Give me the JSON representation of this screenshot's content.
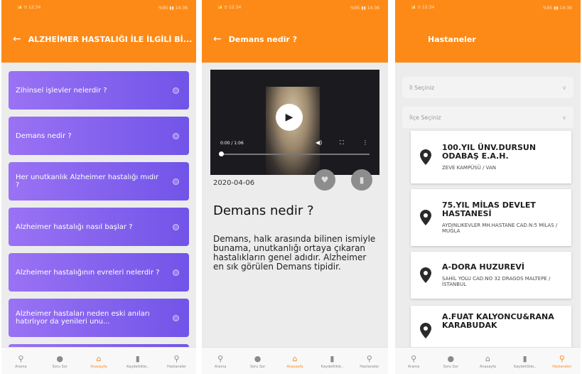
{
  "status": {
    "left": "📶 ⏲ 12:34",
    "right": "%95 ▮▮ 14:36"
  },
  "nav": {
    "items": [
      {
        "icon": "search-icon",
        "label": "Arama"
      },
      {
        "icon": "chat-icon",
        "label": "Soru Sor"
      },
      {
        "icon": "home-icon",
        "label": "Anasayfa"
      },
      {
        "icon": "bookmark-icon",
        "label": "Kaydettikle.."
      },
      {
        "icon": "location-pin-icon",
        "label": "Hastaneler"
      }
    ]
  },
  "screen1": {
    "title": "ALZHEİMER HASTALIĞI İLE İLGİLİ Bİ...",
    "questions": [
      "Zihinsel  işlevler nelerdir ?",
      "Demans nedir ?",
      "Her unutkanlık Alzheimer hastalığı mıdır ?",
      "Alzheimer hastalığı nasıl başlar ?",
      "Alzheimer hastalığının evreleri nelerdir ?",
      "Alzheimer hastaları neden eski anıları hatırlıyor da yenileri unu..."
    ],
    "active_nav": 2
  },
  "screen2": {
    "title": "Demans nedir ?",
    "video_time": "0:00 / 1:06",
    "date": "2020-04-06",
    "heading": "Demans nedir ?",
    "body": "Demans, halk arasında bilinen ismiyle bunama, unutkanlığı ortaya çıkaran hastalıkların genel adıdır. Alzheimer en sık görülen Demans tipidir.",
    "active_nav": 2
  },
  "screen3": {
    "title": "Hastaneler",
    "city_placeholder": "İl Seçiniz",
    "district_placeholder": "İlçe Seçiniz",
    "hospitals": [
      {
        "name": "100.YIL ÜNV.DURSUN ODABAŞ E.A.H.",
        "address": "ZEVE KAMPÜSÜ  / VAN"
      },
      {
        "name": "75.YIL MİLAS DEVLET HASTANESİ",
        "address": "AYDINLIKEVLER MH.HASTANE CAD.N:5 MİLAS / MUĞLA"
      },
      {
        "name": "A-DORA HUZUREVİ",
        "address": "SAHİL YOLU CAD.NO 32 DRAGOS MALTEPE / İSTANBUL"
      },
      {
        "name": "A.FUAT KALYONCU&RANA KARABUDAK",
        "address": ""
      }
    ],
    "active_nav": 4
  },
  "colors": {
    "accent": "#fd8a17",
    "card_gradient_start": "#9a72f4",
    "card_gradient_end": "#7154e8"
  }
}
